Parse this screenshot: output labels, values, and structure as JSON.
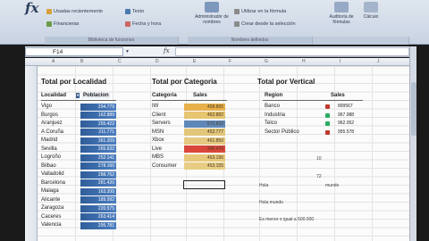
{
  "ribbon": {
    "items": [
      "Usadas recientemente",
      "Financieras",
      "Texto",
      "Fecha y hora",
      "Utilizar en la fórmula",
      "Crear desde la selección",
      "Administrador de nombres",
      "Auditoría de fórmulas",
      "Cálculo"
    ],
    "groups": [
      "Biblioteca de funciones",
      "Nombres definidos"
    ]
  },
  "formula_bar": {
    "name_box": "F14",
    "fx": "fx",
    "value": ""
  },
  "columns": [
    "A",
    "B",
    "C",
    "D",
    "E",
    "F",
    "G",
    "H",
    "I",
    "J"
  ],
  "localidad": {
    "title": "Total por Localidad",
    "header_localidad": "Localidad",
    "header_poblacion": "Poblacion",
    "rows": [
      {
        "name": "Vigo",
        "value": "294.779"
      },
      {
        "name": "Burgos",
        "value": "162.889"
      },
      {
        "name": "Aranjuez",
        "value": "255.422"
      },
      {
        "name": "A Coruña",
        "value": "211.771"
      },
      {
        "name": "Madrid",
        "value": "361.209"
      },
      {
        "name": "Sevilla",
        "value": "265.632"
      },
      {
        "name": "Logroño",
        "value": "252.141"
      },
      {
        "name": "Bilbao",
        "value": "278.160"
      },
      {
        "name": "Valladolid",
        "value": "288.762"
      },
      {
        "name": "Barcelona",
        "value": "281.420"
      },
      {
        "name": "Malaga",
        "value": "163.200"
      },
      {
        "name": "Alicante",
        "value": "189.992"
      },
      {
        "name": "Zaragoza",
        "value": "220.575"
      },
      {
        "name": "Caceres",
        "value": "263.414"
      },
      {
        "name": "Valencia",
        "value": "295.781"
      }
    ]
  },
  "categoria": {
    "title": "Total por Categoria",
    "header_categoria": "Categoria",
    "header_sales": "Sales",
    "rows": [
      {
        "name": "IW",
        "value": "458.865",
        "color": "#e8b04a"
      },
      {
        "name": "Client",
        "value": "462.882",
        "color": "#e6c470"
      },
      {
        "name": "Servers",
        "value": "571.622",
        "color": "#5f88b8"
      },
      {
        "name": "MSN",
        "value": "452.777",
        "color": "#e2c67a"
      },
      {
        "name": "Xbox",
        "value": "461.850",
        "color": "#e4c980"
      },
      {
        "name": "Live",
        "value": "396.470",
        "color": "#d9473a"
      },
      {
        "name": "MBS",
        "value": "463.196",
        "color": "#e6c878"
      },
      {
        "name": "Consumer",
        "value": "453.155",
        "color": "#e8cc84"
      }
    ]
  },
  "vertical": {
    "title": "Total por Vertical",
    "header_region": "Region",
    "header_sales": "Sales",
    "rows": [
      {
        "name": "Banco",
        "value": "899567"
      },
      {
        "name": "Industria",
        "value": "967.988"
      },
      {
        "name": "Telco",
        "value": "962.052"
      },
      {
        "name": "Sector Público",
        "value": "955.578"
      }
    ]
  },
  "misc": {
    "v10": "10",
    "v72": "72",
    "hola": "Hola",
    "mundo": "mundo",
    "hola_mundo": "Hola mundo",
    "menor": "Es menor o igual a 500.000"
  }
}
